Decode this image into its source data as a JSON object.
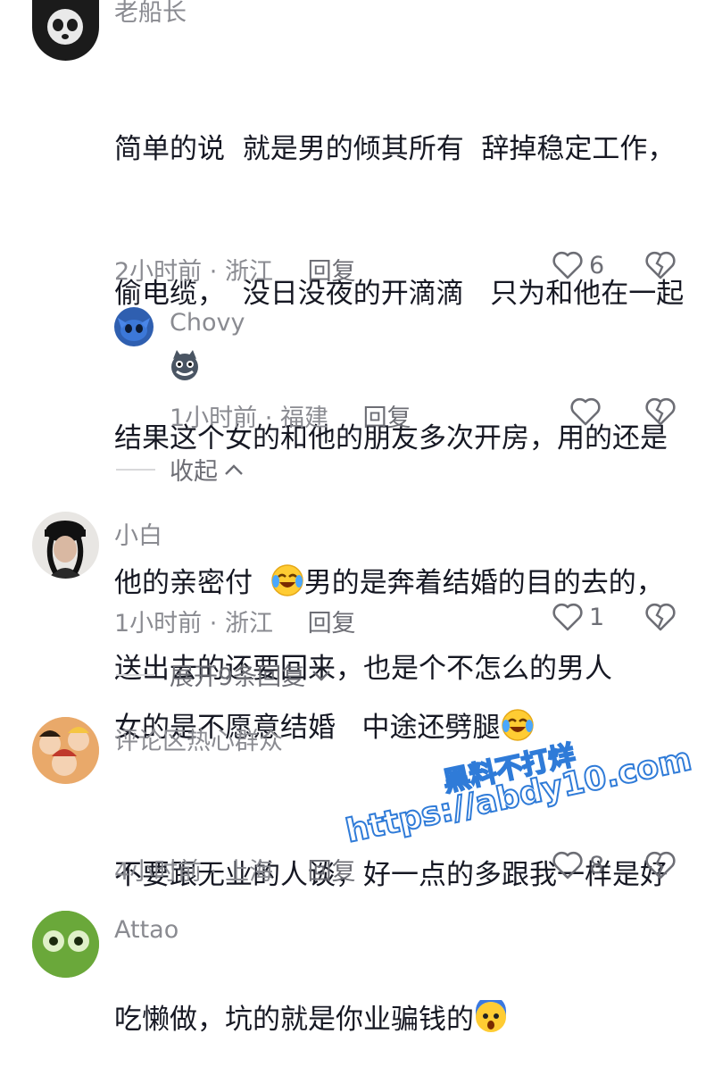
{
  "comments": [
    {
      "author": "老船长",
      "lines": [
        "简单的说  就是男的倾其所有  辞掉稳定工作，",
        "偷电缆，  没日没夜的开滴滴   只为和他在一起",
        "结果这个女的和他的朋友多次开房，用的还是",
        "他的亲密付",
        "男的是奔着结婚的目的去的，",
        "女的是不愿意结婚   中途还劈腿"
      ],
      "time": "2小时前",
      "location": "浙江",
      "reply_label": "回复",
      "likes": "6"
    },
    {
      "author": "Chovy",
      "time": "1小时前",
      "location": "福建",
      "reply_label": "回复",
      "likes": ""
    },
    {
      "collapse_label": "收起"
    },
    {
      "author": "小白",
      "lines": [
        "送出去的还要回来，也是个不怎么的男人"
      ],
      "time": "1小时前",
      "location": "浙江",
      "reply_label": "回复",
      "likes": "1",
      "expand_label": "展开9条回复"
    },
    {
      "author": "评论区热心群众",
      "lines": [
        "不要跟无业的人谈，好一点的多跟我一样是好",
        "吃懒做，坑的就是你业骗钱的"
      ],
      "time": "4小时前",
      "location": "上海",
      "reply_label": "回复",
      "likes": "8"
    },
    {
      "author": "Attao"
    }
  ],
  "watermark": {
    "line1": "黑料不打烊",
    "line2": "https://abdy10.com"
  },
  "meta_separator": "·",
  "icons": {
    "like": "heart-outline-icon",
    "dislike": "broken-heart-icon",
    "fold": "chevron-up-icon",
    "expand": "chevron-down-icon"
  },
  "colors": {
    "text": "#161823",
    "secondary": "#8a8b91",
    "watermark": "#2f7bd8"
  }
}
